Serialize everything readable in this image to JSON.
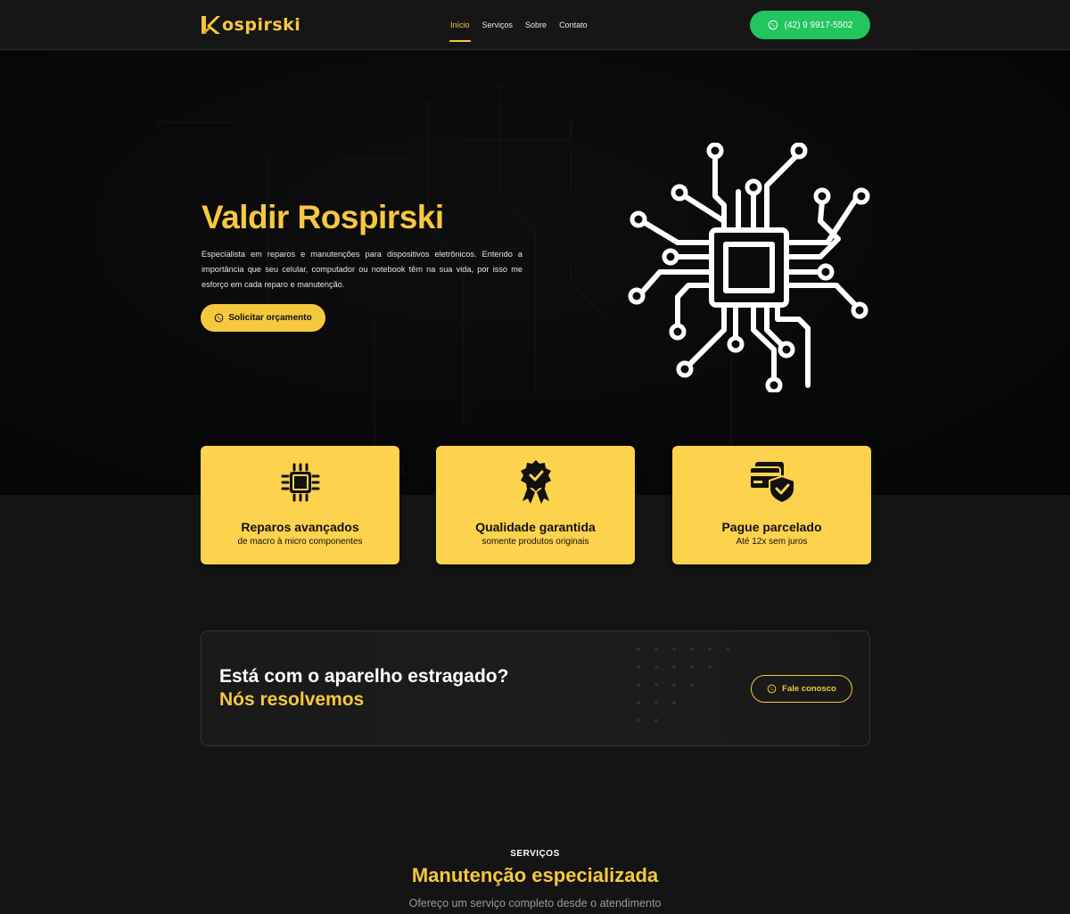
{
  "colors": {
    "accent": "#f6c83d",
    "whatsapp": "#22c55e",
    "background": "#141414"
  },
  "header": {
    "logo": {
      "letter_icon": "k-logo-icon",
      "text": "ospirski"
    },
    "nav": [
      {
        "label": "Início",
        "active": true
      },
      {
        "label": "Serviços",
        "active": false
      },
      {
        "label": "Sobre",
        "active": false
      },
      {
        "label": "Contato",
        "active": false
      }
    ],
    "phone_button": {
      "icon": "whatsapp-icon",
      "label": "(42) 9 9917-5502"
    }
  },
  "hero": {
    "title": "Valdir Rospirski",
    "description": "Especialista em reparos e manutenções para dispositivos eletrônicos. Entendo a importância que seu celular, computador ou notebook têm na sua vida, por isso  me esforço em cada reparo e manutenção.",
    "cta": {
      "icon": "whatsapp-icon",
      "label": "Solicitar orçamento"
    },
    "graphic": "circuit-chip-icon"
  },
  "features": [
    {
      "icon": "cpu-chip-icon",
      "title": "Reparos avançados",
      "subtitle": "de macro à micro componentes"
    },
    {
      "icon": "quality-badge-icon",
      "title": "Qualidade garantida",
      "subtitle": "somente produtos originais"
    },
    {
      "icon": "credit-card-shield-icon",
      "title": "Pague parcelado",
      "subtitle": "Até 12x sem juros"
    }
  ],
  "cta_banner": {
    "line1": "Está com o aparelho estragado?",
    "line2": "Nós resolvemos",
    "button": {
      "icon": "whatsapp-icon",
      "label": "Fale conosco"
    }
  },
  "services": {
    "label": "SERVIÇOS",
    "title": "Manutenção especializada",
    "description": "Ofereço um serviço completo desde o atendimento"
  }
}
